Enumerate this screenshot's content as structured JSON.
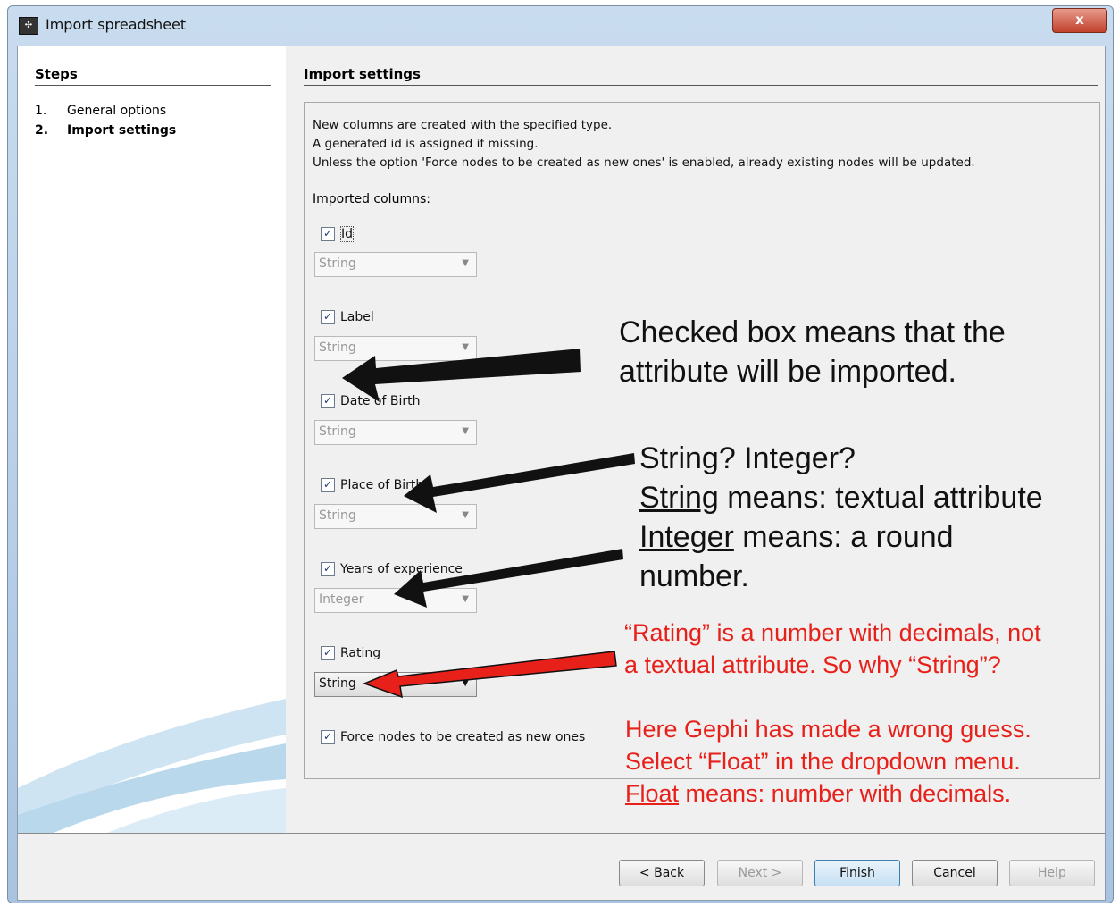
{
  "window": {
    "title": "Import spreadsheet",
    "close_label": "x",
    "icon": "app-icon"
  },
  "steps": {
    "heading": "Steps",
    "items": [
      {
        "num": "1.",
        "label": "General options"
      },
      {
        "num": "2.",
        "label": "Import settings"
      }
    ]
  },
  "settings": {
    "heading": "Import settings",
    "description": [
      "New columns are created with the specified type.",
      "A generated id is assigned if missing.",
      "Unless the option 'Force nodes to be created as new ones' is enabled, already existing nodes will be updated."
    ],
    "columns_label": "Imported columns:",
    "columns": [
      {
        "name": "Id",
        "checked": true,
        "type": "String"
      },
      {
        "name": "Label",
        "checked": true,
        "type": "String"
      },
      {
        "name": "Date of Birth",
        "checked": true,
        "type": "String"
      },
      {
        "name": "Place of Birth",
        "checked": true,
        "type": "String"
      },
      {
        "name": "Years of experience",
        "checked": true,
        "type": "Integer"
      },
      {
        "name": "Rating",
        "checked": true,
        "type": "String"
      }
    ],
    "force_new": {
      "label": "Force nodes to be created as new ones",
      "checked": true
    }
  },
  "buttons": {
    "back": "< Back",
    "next": "Next >",
    "finish": "Finish",
    "cancel": "Cancel",
    "help": "Help"
  },
  "annotations": {
    "checked_note": [
      "Checked box means that the",
      "attribute will be imported."
    ],
    "type_note": {
      "line1": "String? Integer?",
      "string_word": "String",
      "string_rest": " means: textual attribute",
      "integer_word": "Integer",
      "integer_rest": " means: a round",
      "line4": "number."
    },
    "rating_note": [
      "“Rating” is a number with decimals, not",
      "a textual attribute. So why “String”?"
    ],
    "gephi_note": {
      "line1": "Here Gephi has made a wrong guess.",
      "line2": "Select “Float” in the dropdown menu.",
      "float_word": "Float",
      "float_rest": " means: number with decimals."
    },
    "colors": {
      "black": "#111111",
      "red": "#e8201a"
    }
  }
}
